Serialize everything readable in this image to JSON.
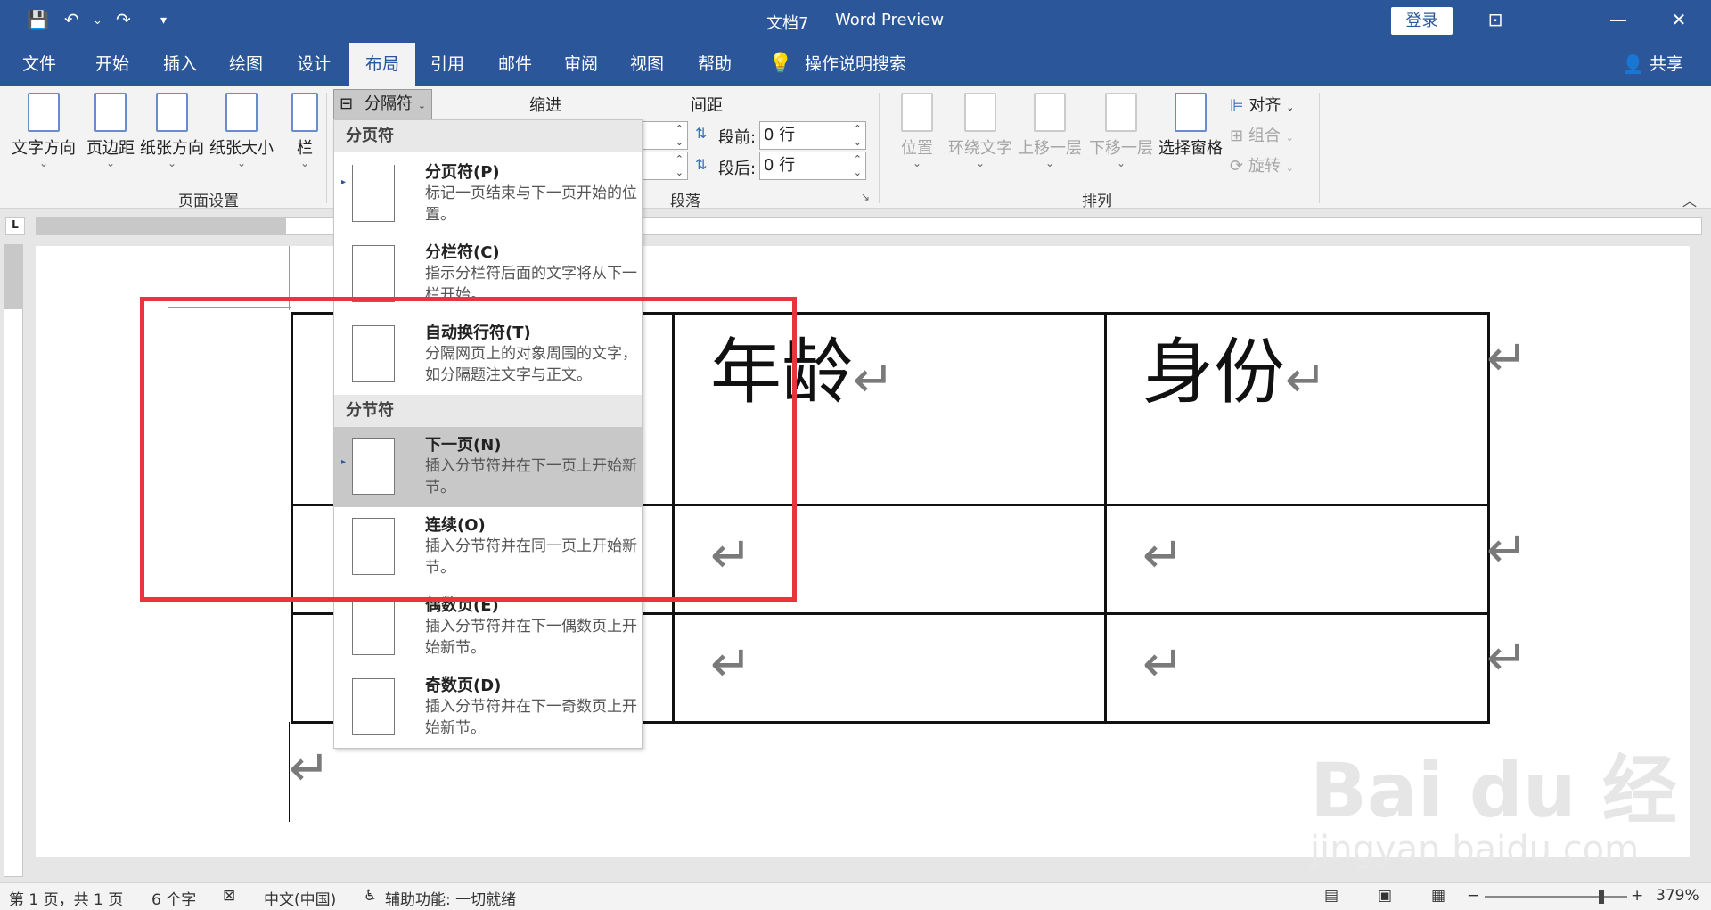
{
  "titlebar": {
    "doc_title": "文档7",
    "app_title": "Word Preview",
    "login": "登录"
  },
  "tabs": [
    "文件",
    "开始",
    "插入",
    "绘图",
    "设计",
    "布局",
    "引用",
    "邮件",
    "审阅",
    "视图",
    "帮助"
  ],
  "search": "操作说明搜索",
  "share": "共享",
  "ribbon": {
    "page_setup": {
      "text_direction": "文字方向",
      "margins": "页边距",
      "orientation": "纸张方向",
      "size": "纸张大小",
      "columns": "栏",
      "breaks": "分隔符",
      "group": "页面设置"
    },
    "paragraph": {
      "indent": "缩进",
      "spacing": "间距",
      "before_label": "段前:",
      "before_value": "0 行",
      "after_label": "段后:",
      "after_value": "0 行",
      "group": "段落"
    },
    "arrange": {
      "position": "位置",
      "wrap": "环绕文字",
      "forward": "上移一层",
      "backward": "下移一层",
      "selection_pane": "选择窗格",
      "align": "对齐",
      "group_btn": "组合",
      "rotate": "旋转",
      "group": "排列"
    }
  },
  "menu": {
    "page_breaks_header": "分页符",
    "section_breaks_header": "分节符",
    "items": [
      {
        "title": "分页符(P)",
        "desc": "标记一页结束与下一页开始的位置。"
      },
      {
        "title": "分栏符(C)",
        "desc": "指示分栏符后面的文字将从下一栏开始。"
      },
      {
        "title": "自动换行符(T)",
        "desc": "分隔网页上的对象周围的文字，如分隔题注文字与正文。"
      },
      {
        "title": "下一页(N)",
        "desc": "插入分节符并在下一页上开始新节。"
      },
      {
        "title": "连续(O)",
        "desc": "插入分节符并在同一页上开始新节。"
      },
      {
        "title": "偶数页(E)",
        "desc": "插入分节符并在下一偶数页上开始新节。"
      },
      {
        "title": "奇数页(D)",
        "desc": "插入分节符并在下一奇数页上开始新节。"
      }
    ]
  },
  "table": {
    "header": [
      "",
      "年龄",
      "身份"
    ],
    "return_mark": "↵"
  },
  "status": {
    "page": "第 1 页，共 1 页",
    "words": "6 个字",
    "language": "中文(中国)",
    "accessibility": "辅助功能: 一切就绪",
    "zoom": "379%"
  },
  "watermark": {
    "brand": "Bai du 经验",
    "url": "jingyan.baidu.com"
  }
}
